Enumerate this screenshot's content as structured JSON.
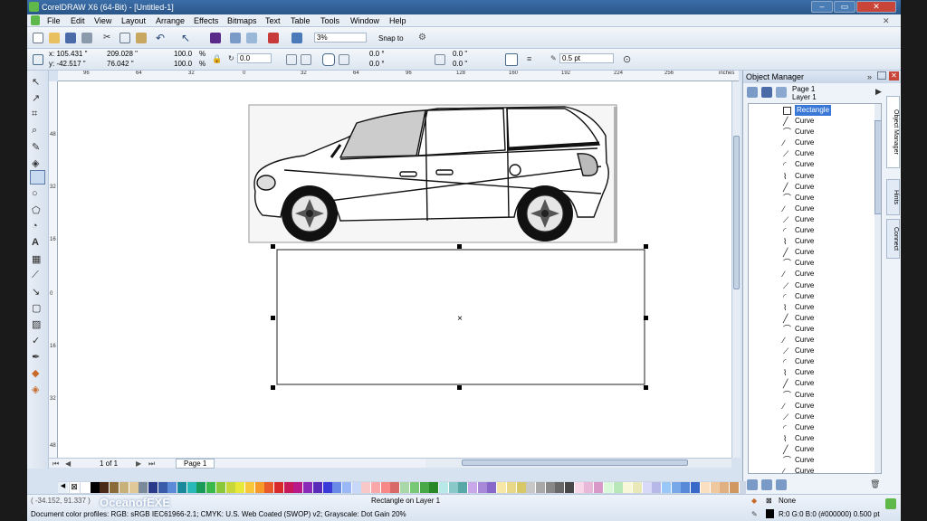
{
  "window": {
    "title": "CorelDRAW X6 (64-Bit) - [Untitled-1]",
    "minimize": "–",
    "restore": "▭",
    "close": "✕"
  },
  "menu": [
    "File",
    "Edit",
    "View",
    "Layout",
    "Arrange",
    "Effects",
    "Bitmaps",
    "Text",
    "Table",
    "Tools",
    "Window",
    "Help"
  ],
  "standard_toolbar": {
    "zoom": "3%",
    "snap": "Snap to"
  },
  "property_bar": {
    "x": "x: 105.431 \"",
    "y": "y: -42.517 \"",
    "w": "209.028 \"",
    "h": "76.042 \"",
    "sx": "100.0",
    "sy": "100.0",
    "pct1": "%",
    "pct2": "%",
    "rotation": "0.0",
    "corner_top": "0.0 °",
    "corner_bottom": "0.0 °",
    "corner_top2": "0.0 \"",
    "corner_bottom2": "0.0 \"",
    "outline": "0.5 pt"
  },
  "ruler": {
    "unit": "inches",
    "h_ticks": [
      "96",
      "64",
      "32",
      "0",
      "32",
      "64",
      "96",
      "128",
      "160",
      "192",
      "224",
      "256"
    ],
    "v_ticks": [
      "48",
      "32",
      "16",
      "0",
      "16",
      "32",
      "48"
    ]
  },
  "docker": {
    "title": "Object Manager",
    "page": "Page 1",
    "layer": "Layer 1",
    "selected": "Rectangle",
    "items": [
      "Curve",
      "Curve",
      "Curve",
      "Curve",
      "Curve",
      "Curve",
      "Curve",
      "Curve",
      "Curve",
      "Curve",
      "Curve",
      "Curve",
      "Curve",
      "Curve",
      "Curve",
      "Curve",
      "Curve",
      "Curve",
      "Curve",
      "Curve",
      "Curve",
      "Curve",
      "Curve",
      "Curve",
      "Curve",
      "Curve",
      "Curve",
      "Curve",
      "Curve",
      "Curve",
      "Curve",
      "Curve",
      "Curve"
    ],
    "tabs": [
      "Object Manager",
      "Hints",
      "Connect"
    ]
  },
  "page_nav": {
    "of": "1 of 1",
    "tab": "Page 1"
  },
  "palette": [
    "#ffffff",
    "#000000",
    "#4a2b1a",
    "#8b6b3a",
    "#c8b07a",
    "#e0c898",
    "#7a8a9a",
    "#2a3a8a",
    "#3a5aaa",
    "#5a8ad8",
    "#1a8a9a",
    "#2ab8b8",
    "#1a9a5a",
    "#3ab84a",
    "#8ac83a",
    "#c8d83a",
    "#e8e83a",
    "#f8c83a",
    "#f89a2a",
    "#e85a2a",
    "#d82a2a",
    "#c81a5a",
    "#b81a8a",
    "#8a2ab8",
    "#5a2ab8",
    "#3a3ad8",
    "#6a8ae8",
    "#9ab8f8",
    "#c8d8f8",
    "#f8c8c8",
    "#f8a8a8",
    "#f88888",
    "#d86a6a",
    "#a8d8a8",
    "#78c878",
    "#48a848",
    "#288828",
    "#b8e8e8",
    "#88c8c8",
    "#58a8a8",
    "#c8a8e8",
    "#a888d8",
    "#8868c8",
    "#f8e8a8",
    "#e8d888",
    "#d8c868",
    "#c8c8c8",
    "#a8a8a8",
    "#888888",
    "#686868",
    "#484848",
    "#f8d8e8",
    "#e8b8d8",
    "#d898c8",
    "#d8f8d8",
    "#b8e8b8",
    "#f8f8d8",
    "#e8e8b8",
    "#d8d8f8",
    "#b8b8e8",
    "#98c8f8",
    "#78a8e8",
    "#5888d8",
    "#3868c8",
    "#fae0c0",
    "#f0c8a0",
    "#e0b080",
    "#d09860"
  ],
  "status": {
    "coords": "( -34.152, 91.337 )",
    "info": "Rectangle on Layer 1",
    "profiles": "Document color profiles: RGB: sRGB IEC61966-2.1; CMYK: U.S. Web Coated (SWOP) v2; Grayscale: Dot Gain 20%",
    "fill": "None",
    "outline": "R:0 G:0 B:0 (#000000)  0.500 pt"
  },
  "watermark": "OceanofEXE"
}
